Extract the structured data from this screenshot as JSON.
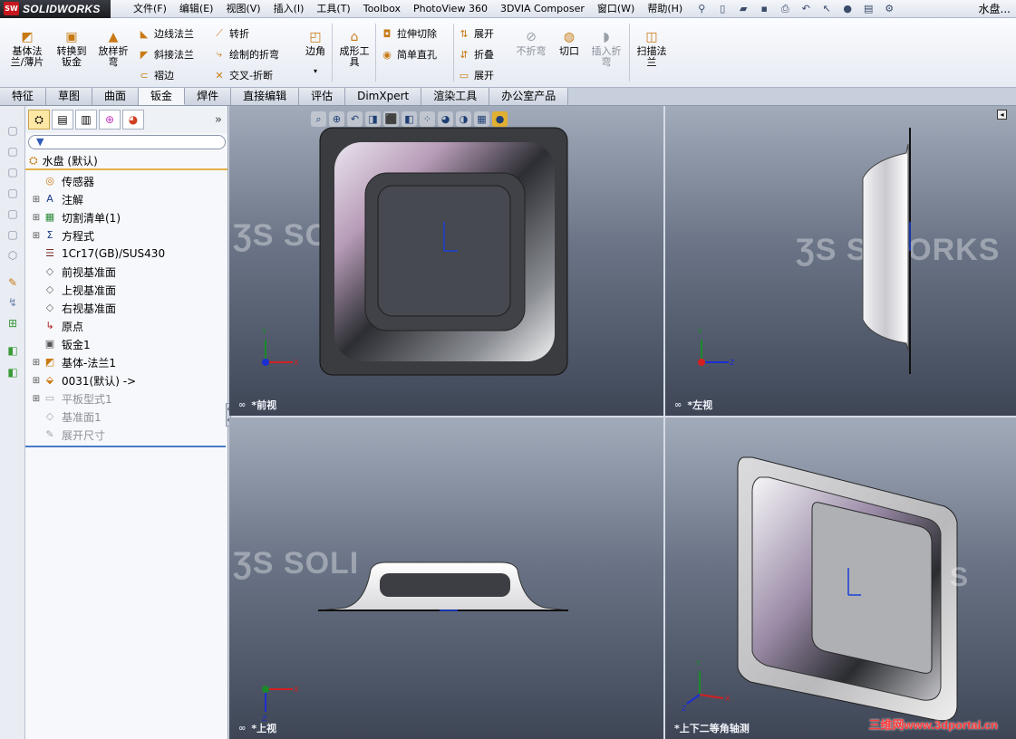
{
  "app": {
    "logo_mark": "SW",
    "logo_text": "SOLIDWORKS",
    "doc_title": "水盘..."
  },
  "menu": [
    "文件(F)",
    "编辑(E)",
    "视图(V)",
    "插入(I)",
    "工具(T)",
    "Toolbox",
    "PhotoView 360",
    "3DVIA Composer",
    "窗口(W)",
    "帮助(H)"
  ],
  "quick_icons": [
    "pin-icon",
    "new-document-icon",
    "open-icon",
    "save-icon",
    "print-icon",
    "undo-icon",
    "select-icon",
    "rebuild-icon",
    "file-properties-icon",
    "options-icon"
  ],
  "ribbon": {
    "base_flange": "基体法\n兰/薄片",
    "convert_to_sheet": "转换到\n钣金",
    "lofted_bend": "放样折\n弯",
    "edge_flange": "边线法兰",
    "miter_flange": "斜接法兰",
    "hem": "褶边",
    "jog": "转折",
    "sketched_bend": "绘制的折弯",
    "cross_break": "交叉-折断",
    "corners": "边角",
    "forming_tool": "成形工\n具",
    "extruded_cut": "拉伸切除",
    "simple_hole": "简单直孔",
    "unfold": "展开",
    "fold": "折叠",
    "flatten": "展开",
    "no_bends": "不折弯",
    "rip": "切口",
    "insert_bends": "插入折\n弯",
    "swept_flange": "扫描法\n兰"
  },
  "tabs": [
    "特征",
    "草图",
    "曲面",
    "钣金",
    "焊件",
    "直接编辑",
    "评估",
    "DimXpert",
    "渲染工具",
    "办公室产品"
  ],
  "active_tab": "钣金",
  "feature_manager": {
    "root": "水盘 (默认)",
    "items": [
      {
        "label": "传感器",
        "expandable": false,
        "icon": "sensor-icon",
        "dim": false
      },
      {
        "label": "注解",
        "expandable": true,
        "icon": "annotation-icon",
        "dim": false
      },
      {
        "label": "切割清单(1)",
        "expandable": true,
        "icon": "cut-list-icon",
        "dim": false
      },
      {
        "label": "方程式",
        "expandable": true,
        "icon": "equation-icon",
        "dim": false
      },
      {
        "label": "1Cr17(GB)/SUS430",
        "expandable": false,
        "icon": "material-icon",
        "dim": false
      },
      {
        "label": "前视基准面",
        "expandable": false,
        "icon": "plane-icon",
        "dim": false
      },
      {
        "label": "上视基准面",
        "expandable": false,
        "icon": "plane-icon",
        "dim": false
      },
      {
        "label": "右视基准面",
        "expandable": false,
        "icon": "plane-icon",
        "dim": false
      },
      {
        "label": "原点",
        "expandable": false,
        "icon": "origin-icon",
        "dim": false
      },
      {
        "label": "钣金1",
        "expandable": false,
        "icon": "sheet-metal-icon",
        "dim": false
      },
      {
        "label": "基体-法兰1",
        "expandable": true,
        "icon": "base-flange-icon",
        "dim": false
      },
      {
        "label": "0031(默认) ->",
        "expandable": true,
        "icon": "forming-tool-icon",
        "dim": false
      },
      {
        "label": "平板型式1",
        "expandable": true,
        "icon": "flat-pattern-icon",
        "dim": true
      },
      {
        "label": "基准面1",
        "expandable": false,
        "icon": "plane-icon",
        "dim": true
      },
      {
        "label": "展开尺寸",
        "expandable": false,
        "icon": "sketch-icon",
        "dim": true
      }
    ]
  },
  "viewports": {
    "front": "*前视",
    "left": "*左视",
    "top": "*上视",
    "iso": "*上下二等角轴测"
  },
  "watermark": {
    "brand_left": "SOLI",
    "brand_right": "WORKS",
    "site": "三维网www.3dportal.cn"
  },
  "colors": {
    "accent": "#c87a14",
    "viewport_top": "#a2abba",
    "viewport_bottom": "#3e4656",
    "logo_red": "#c8161d"
  }
}
